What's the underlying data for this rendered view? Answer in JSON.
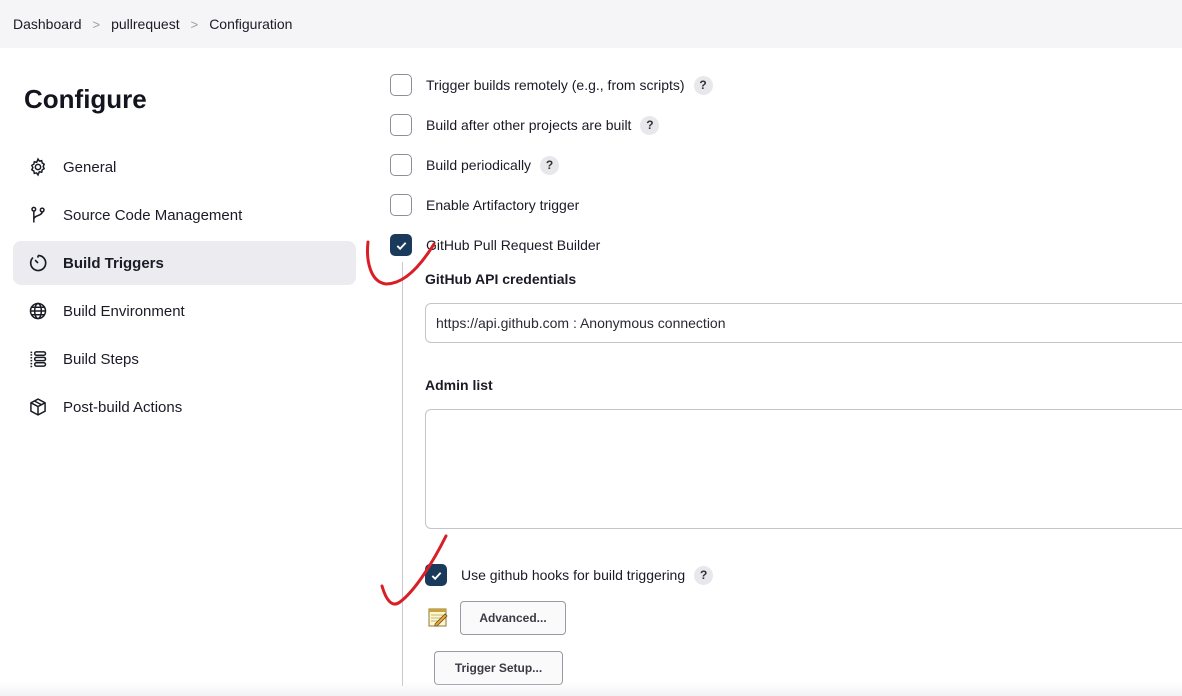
{
  "breadcrumb": {
    "items": [
      "Dashboard",
      "pullrequest",
      "Configuration"
    ],
    "separator": ">"
  },
  "sidebar": {
    "title": "Configure",
    "items": [
      {
        "label": "General",
        "icon": "gear-icon",
        "active": false
      },
      {
        "label": "Source Code Management",
        "icon": "branch-icon",
        "active": false
      },
      {
        "label": "Build Triggers",
        "icon": "clock-icon",
        "active": true
      },
      {
        "label": "Build Environment",
        "icon": "globe-icon",
        "active": false
      },
      {
        "label": "Build Steps",
        "icon": "list-icon",
        "active": false
      },
      {
        "label": "Post-build Actions",
        "icon": "package-icon",
        "active": false
      }
    ]
  },
  "triggers": [
    {
      "label": "Trigger builds remotely (e.g., from scripts)",
      "checked": false,
      "help": "?"
    },
    {
      "label": "Build after other projects are built",
      "checked": false,
      "help": "?"
    },
    {
      "label": "Build periodically",
      "checked": false,
      "help": "?"
    },
    {
      "label": "Enable Artifactory trigger",
      "checked": false
    },
    {
      "label": "GitHub Pull Request Builder",
      "checked": true
    }
  ],
  "ghprb": {
    "credentials_label": "GitHub API credentials",
    "credentials_value": "https://api.github.com : Anonymous connection",
    "admin_list_label": "Admin list",
    "admin_list_value": "",
    "hooks_label": "Use github hooks for build triggering",
    "hooks_checked": true,
    "hooks_help": "?",
    "advanced_label": "Advanced...",
    "trigger_setup_label": "Trigger Setup..."
  },
  "colors": {
    "checkbox_checked": "#1a3a5c",
    "annotation_red": "#d81f26",
    "active_nav_bg": "#ececf0"
  }
}
